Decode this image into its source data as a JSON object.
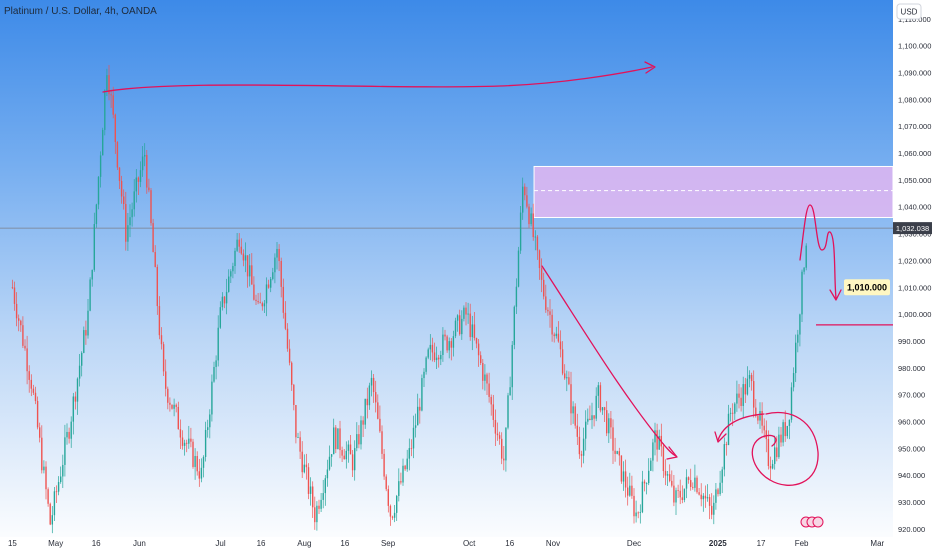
{
  "title": "Platinum / U.S. Dollar, 4h, OANDA",
  "currency_button": "USD",
  "current_price_label": "1,032.038",
  "target_label": "1,010.000",
  "colors": {
    "up": "#26a69a",
    "down": "#ef5350",
    "annotation": "#e2125a",
    "zone_fill": "#e1b6f1",
    "price_line": "#7a7f8a",
    "target_bg": "#fff7c2"
  },
  "chart_data": {
    "type": "candlestick",
    "title": "Platinum / U.S. Dollar, 4h, OANDA",
    "ylim": [
      917,
      1117
    ],
    "y_ticks": [
      920,
      930,
      940,
      950,
      960,
      970,
      980,
      990,
      1000,
      1010,
      1020,
      1030,
      1040,
      1050,
      1060,
      1070,
      1080,
      1090,
      1100,
      1110
    ],
    "y_tick_labels": [
      "920.000",
      "930.000",
      "940.000",
      "950.000",
      "960.000",
      "970.000",
      "980.000",
      "990.000",
      "1,000.000",
      "1,010.000",
      "1,020.000",
      "1,030.000",
      "1,040.000",
      "1,050.000",
      "1,060.000",
      "1,070.000",
      "1,080.000",
      "1,090.000",
      "1,100.000",
      "1,110.000"
    ],
    "x_tick_labels": [
      "15",
      "May",
      "16",
      "Jun",
      "Jul",
      "16",
      "Aug",
      "16",
      "Sep",
      "Oct",
      "16",
      "Nov",
      "Dec",
      "2025",
      "17",
      "Feb",
      "Mar"
    ],
    "x_tick_bold": [
      "2025"
    ],
    "price_path": [
      {
        "date": "2024-04-15",
        "value": 1010
      },
      {
        "date": "2024-04-22",
        "value": 975
      },
      {
        "date": "2024-04-29",
        "value": 922
      },
      {
        "date": "2024-05-06",
        "value": 958
      },
      {
        "date": "2024-05-13",
        "value": 1000
      },
      {
        "date": "2024-05-20",
        "value": 1093
      },
      {
        "date": "2024-05-27",
        "value": 1030
      },
      {
        "date": "2024-06-03",
        "value": 1060
      },
      {
        "date": "2024-06-10",
        "value": 975
      },
      {
        "date": "2024-06-17",
        "value": 955
      },
      {
        "date": "2024-06-24",
        "value": 940
      },
      {
        "date": "2024-07-01",
        "value": 1000
      },
      {
        "date": "2024-07-08",
        "value": 1030
      },
      {
        "date": "2024-07-15",
        "value": 1000
      },
      {
        "date": "2024-07-22",
        "value": 1025
      },
      {
        "date": "2024-07-29",
        "value": 955
      },
      {
        "date": "2024-08-05",
        "value": 925
      },
      {
        "date": "2024-08-12",
        "value": 955
      },
      {
        "date": "2024-08-19",
        "value": 945
      },
      {
        "date": "2024-08-26",
        "value": 975
      },
      {
        "date": "2024-09-02",
        "value": 925
      },
      {
        "date": "2024-09-09",
        "value": 948
      },
      {
        "date": "2024-09-16",
        "value": 985
      },
      {
        "date": "2024-09-23",
        "value": 990
      },
      {
        "date": "2024-09-30",
        "value": 1000
      },
      {
        "date": "2024-10-07",
        "value": 975
      },
      {
        "date": "2024-10-14",
        "value": 945
      },
      {
        "date": "2024-10-21",
        "value": 1050
      },
      {
        "date": "2024-10-28",
        "value": 1010
      },
      {
        "date": "2024-11-04",
        "value": 985
      },
      {
        "date": "2024-11-11",
        "value": 950
      },
      {
        "date": "2024-11-18",
        "value": 970
      },
      {
        "date": "2024-11-25",
        "value": 945
      },
      {
        "date": "2024-12-02",
        "value": 925
      },
      {
        "date": "2024-12-09",
        "value": 955
      },
      {
        "date": "2024-12-16",
        "value": 930
      },
      {
        "date": "2024-12-23",
        "value": 940
      },
      {
        "date": "2024-12-30",
        "value": 925
      },
      {
        "date": "2025-01-06",
        "value": 965
      },
      {
        "date": "2025-01-13",
        "value": 975
      },
      {
        "date": "2025-01-20",
        "value": 945
      },
      {
        "date": "2025-01-27",
        "value": 960
      },
      {
        "date": "2025-02-01",
        "value": 1010
      },
      {
        "date": "2025-02-03",
        "value": 1032
      }
    ],
    "current_price": 1032.038,
    "resistance_zone": [
      1036,
      1055
    ],
    "zone_midline": 1046,
    "horizontal_level": 996,
    "projected_target": 1010.0
  }
}
